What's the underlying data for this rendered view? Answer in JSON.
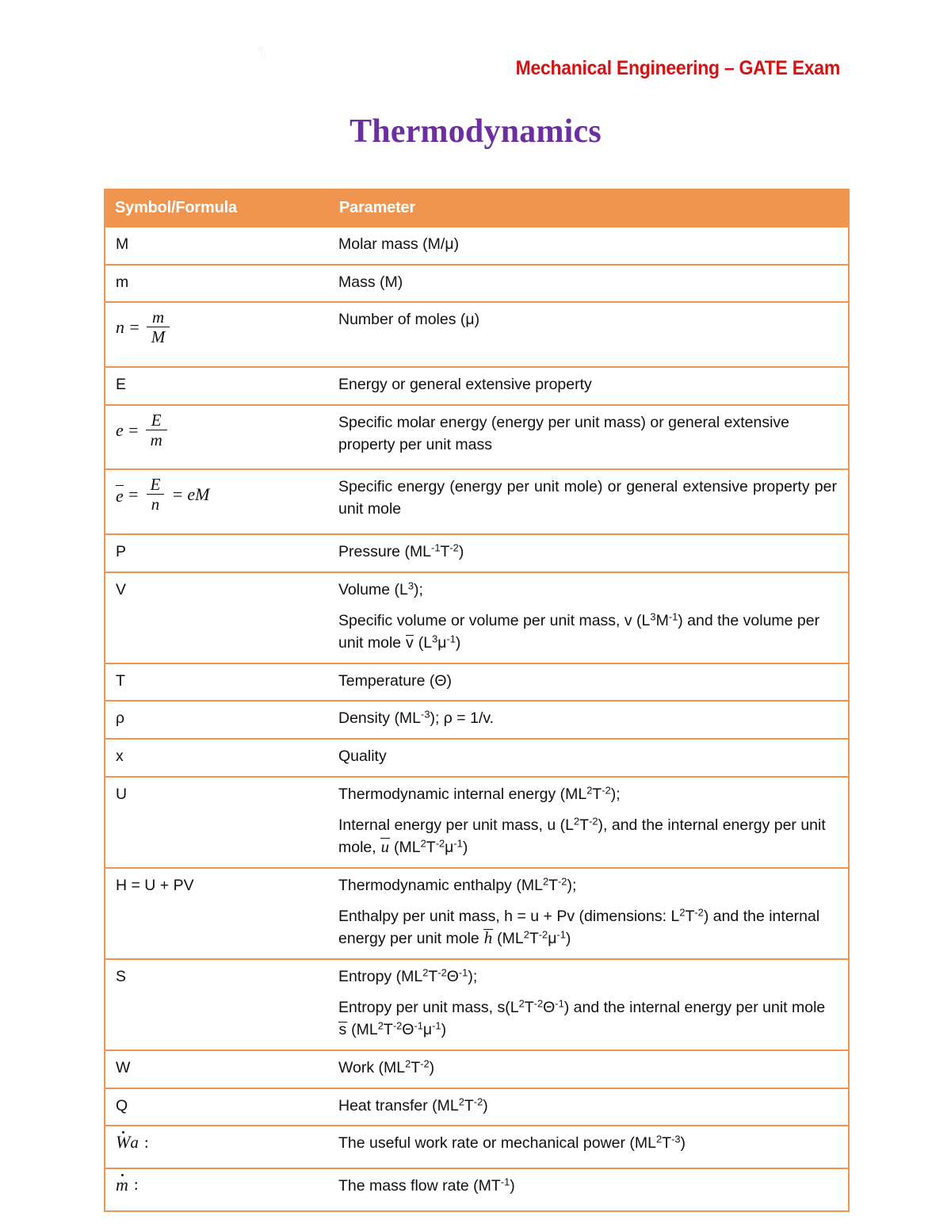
{
  "document": {
    "running_head": "Mechanical Engineering – GATE Exam",
    "title": "Thermodynamics",
    "artifact_glyph": "¶"
  },
  "colors": {
    "running_head": "#d31313",
    "title": "#6b2fa0",
    "table_accent": "#f0954f",
    "header_text": "#ffffff",
    "body_text": "#111111",
    "page_background": "#ffffff"
  },
  "table": {
    "headers": {
      "symbol": "Symbol/Formula",
      "parameter": "Parameter"
    },
    "rows": [
      {
        "symbol_text": "M",
        "symbol_kind": "plain",
        "parameter_lines": [
          "Molar mass  (M/μ)"
        ]
      },
      {
        "symbol_text": "m",
        "symbol_kind": "plain",
        "parameter_lines": [
          "Mass (M)"
        ]
      },
      {
        "symbol_text": "n = m/M",
        "symbol_kind": "fraction",
        "parameter_lines": [
          "Number of moles (μ)"
        ]
      },
      {
        "symbol_text": "E",
        "symbol_kind": "plain",
        "parameter_lines": [
          "Energy or general extensive property"
        ]
      },
      {
        "symbol_text": "e = E/m",
        "symbol_kind": "fraction",
        "parameter_lines": [
          "Specific molar energy (energy per unit mass) or general extensive property per unit mass"
        ]
      },
      {
        "symbol_text": "ē = E/n = eM",
        "symbol_kind": "fraction",
        "parameter_lines": [
          "Specific energy (energy per unit mole) or general extensive property per unit mole"
        ]
      },
      {
        "symbol_text": "P",
        "symbol_kind": "plain",
        "parameter_lines": [
          "Pressure (ML⁻¹T⁻²)"
        ]
      },
      {
        "symbol_text": "V",
        "symbol_kind": "plain",
        "parameter_lines": [
          "Volume (L³);",
          "Specific volume or volume per unit mass, v (L³M⁻¹) and the volume per unit mole v̄ (L³μ⁻¹)"
        ]
      },
      {
        "symbol_text": "T",
        "symbol_kind": "plain",
        "parameter_lines": [
          "Temperature (Θ)"
        ]
      },
      {
        "symbol_text": "ρ",
        "symbol_kind": "plain",
        "parameter_lines": [
          "Density (ML⁻³); ρ = 1/v."
        ]
      },
      {
        "symbol_text": "x",
        "symbol_kind": "plain",
        "parameter_lines": [
          "Quality"
        ]
      },
      {
        "symbol_text": "U",
        "symbol_kind": "plain",
        "parameter_lines": [
          "Thermodynamic internal energy (ML²T⁻²);",
          "Internal energy per unit mass, u (L²T⁻²), and the internal energy per unit mole, ū (ML²T⁻²μ⁻¹)"
        ]
      },
      {
        "symbol_text": "H = U + PV",
        "symbol_kind": "plain",
        "parameter_lines": [
          "Thermodynamic enthalpy (ML²T⁻²);",
          "Enthalpy per unit mass, h = u + Pv (dimensions: L²T⁻²) and the internal energy per unit mole h̄ (ML²T⁻²μ⁻¹)"
        ]
      },
      {
        "symbol_text": "S",
        "symbol_kind": "plain",
        "parameter_lines": [
          "Entropy (ML²T⁻²Θ⁻¹);",
          "Entropy per unit mass, s(L²T⁻²Θ⁻¹) and the internal energy per unit mole s̄ (ML²T⁻²Θ⁻¹μ⁻¹)"
        ]
      },
      {
        "symbol_text": "W",
        "symbol_kind": "plain",
        "parameter_lines": [
          "Work (ML²T⁻²)"
        ]
      },
      {
        "symbol_text": "Q",
        "symbol_kind": "plain",
        "parameter_lines": [
          "Heat transfer (ML²T⁻²)"
        ]
      },
      {
        "symbol_text": "Ẇa :",
        "symbol_kind": "dotted",
        "parameter_lines": [
          "The useful work rate or mechanical power (ML²T⁻³)"
        ]
      },
      {
        "symbol_text": "ṁ :",
        "symbol_kind": "dotted",
        "parameter_lines": [
          "The mass flow rate (MT⁻¹)"
        ]
      }
    ]
  }
}
